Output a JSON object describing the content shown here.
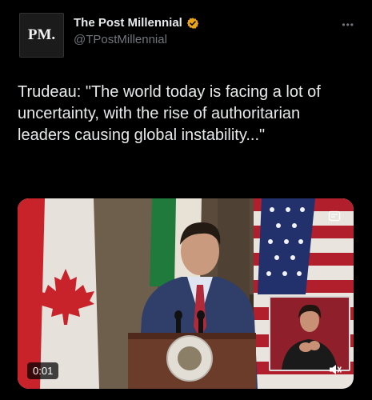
{
  "author": {
    "avatar_text": "PM.",
    "display_name": "The Post Millennial",
    "handle": "@TPostMillennial",
    "verified_color": "#e8a317"
  },
  "tweet": {
    "text": "Trudeau: \"The world today is facing a lot of uncertainty, with the rise of authoritarian leaders causing global instability...\""
  },
  "video": {
    "timestamp": "0:01",
    "icons": [
      "more-options-icon",
      "verified-badge-icon",
      "media-settings-icon",
      "volume-icon"
    ]
  },
  "colors": {
    "background": "#000000",
    "text": "#e7e9ea",
    "secondary": "#71767b"
  }
}
